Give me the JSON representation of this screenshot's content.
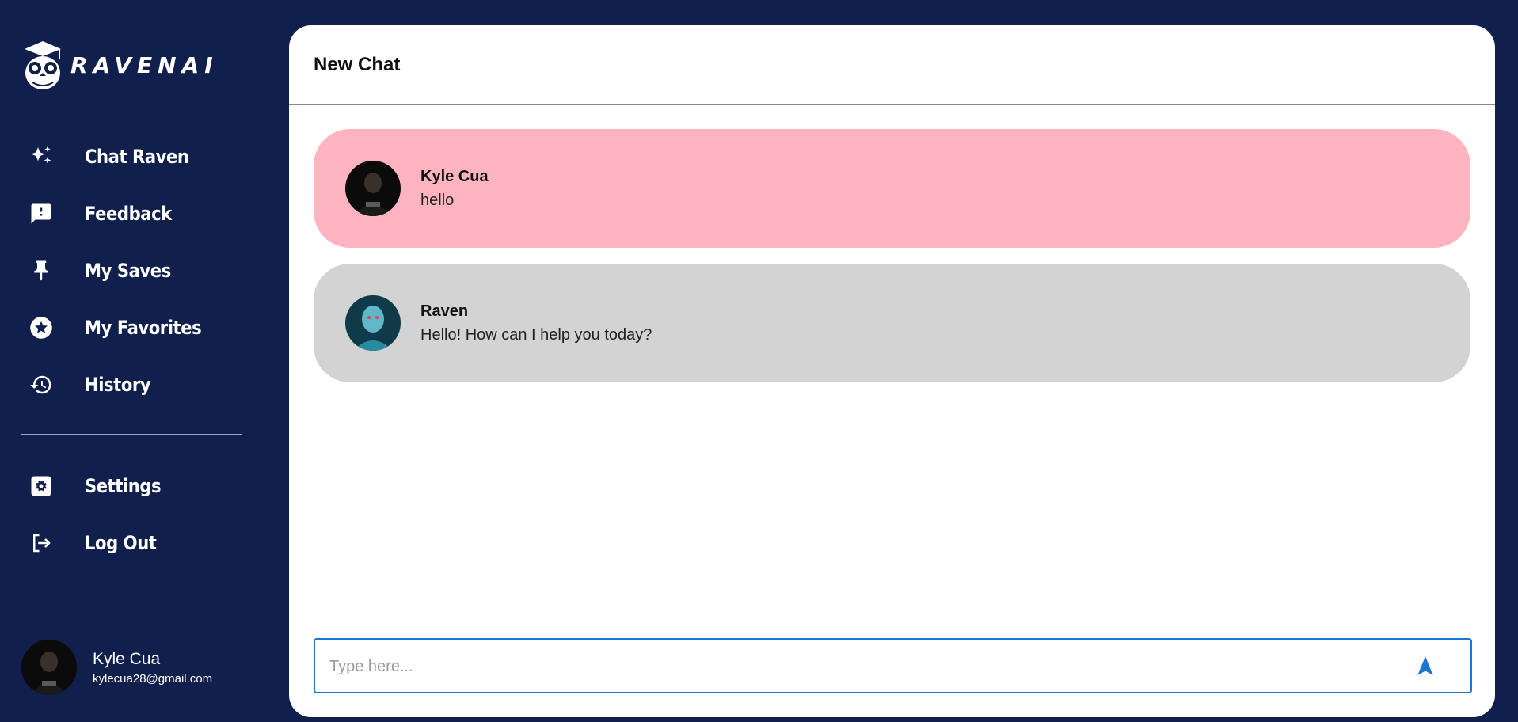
{
  "brand": {
    "name": "RAVENAI"
  },
  "nav": {
    "items": [
      {
        "label": "Chat Raven",
        "icon": "sparkle-icon"
      },
      {
        "label": "Feedback",
        "icon": "feedback-icon"
      },
      {
        "label": "My Saves",
        "icon": "pin-icon"
      },
      {
        "label": "My Favorites",
        "icon": "star-icon"
      },
      {
        "label": "History",
        "icon": "history-icon"
      }
    ],
    "secondary": [
      {
        "label": "Settings",
        "icon": "settings-icon"
      },
      {
        "label": "Log Out",
        "icon": "logout-icon"
      }
    ]
  },
  "user": {
    "name": "Kyle Cua",
    "email": "kylecua28@gmail.com"
  },
  "chat": {
    "title": "New Chat",
    "messages": [
      {
        "sender": "Kyle Cua",
        "text": "hello"
      },
      {
        "sender": "Raven",
        "text": "Hello! How can I help you today?"
      }
    ],
    "input_placeholder": "Type here..."
  },
  "colors": {
    "sidebar_bg": "#101f4b",
    "user_bubble": "#ffb4c0",
    "bot_bubble": "#d3d3d3",
    "accent": "#1976d2"
  }
}
